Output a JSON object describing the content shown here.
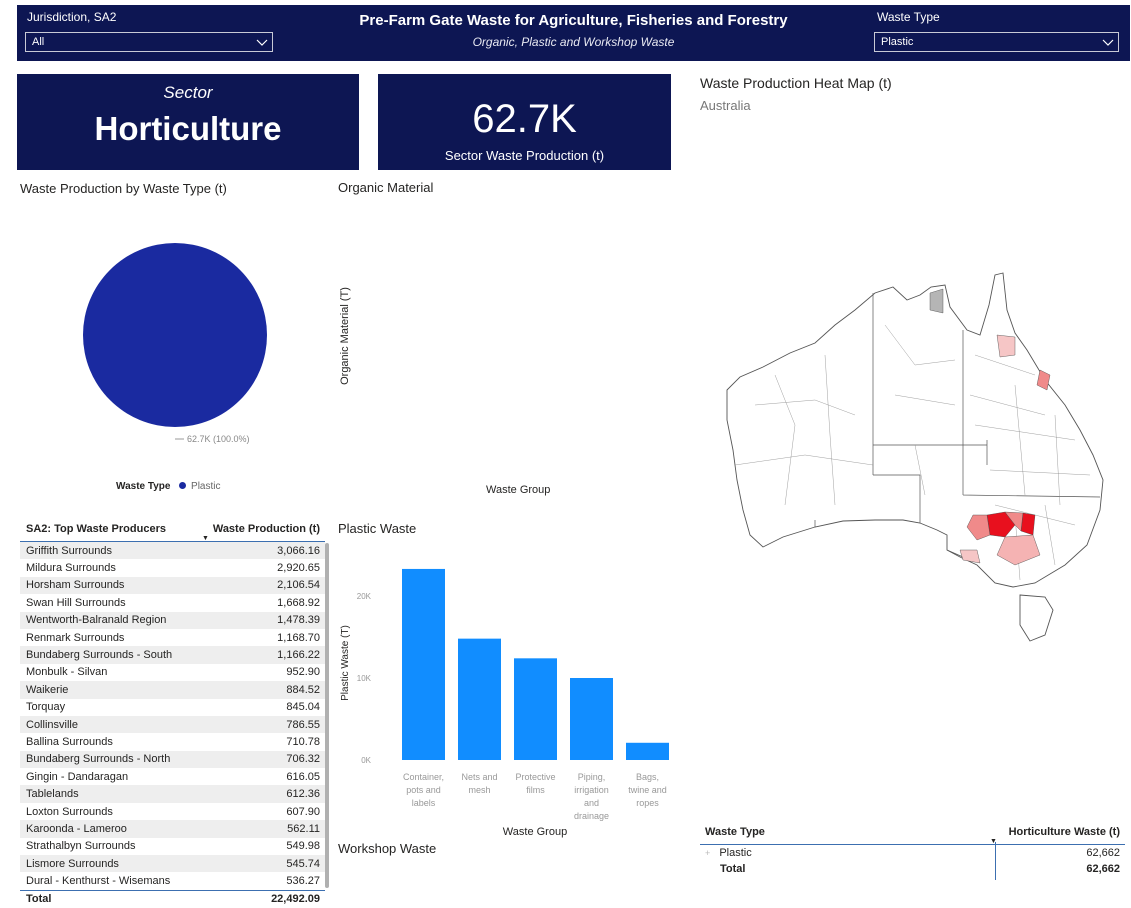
{
  "header": {
    "title": "Pre-Farm Gate Waste for Agriculture, Fisheries and Forestry",
    "subtitle": "Organic, Plastic and Workshop Waste"
  },
  "slicers": {
    "jurisdiction": {
      "label": "Jurisdiction, SA2",
      "value": "All"
    },
    "waste_type": {
      "label": "Waste Type",
      "value": "Plastic"
    }
  },
  "sector_card": {
    "caption": "Sector",
    "value": "Horticulture"
  },
  "production_card": {
    "value": "62.7K",
    "caption": "Sector Waste Production (t)"
  },
  "pie": {
    "title": "Waste Production by Waste Type (t)",
    "data_label": "62.7K (100.0%)",
    "legend_title": "Waste Type",
    "legend_entry": "Plastic",
    "color": "#1a2aa0",
    "chart_data": {
      "type": "pie",
      "categories": [
        "Plastic"
      ],
      "values": [
        62662
      ],
      "title": "Waste Production by Waste Type (t)"
    }
  },
  "organic": {
    "title": "Organic Material",
    "ylabel": "Organic Material (T)",
    "xlabel": "Waste Group"
  },
  "top_producers": {
    "col1": "SA2: Top Waste Producers",
    "col2": "Waste Production (t)",
    "rows": [
      {
        "name": "Griffith Surrounds",
        "value": "3,066.16"
      },
      {
        "name": "Mildura Surrounds",
        "value": "2,920.65"
      },
      {
        "name": "Horsham Surrounds",
        "value": "2,106.54"
      },
      {
        "name": "Swan Hill Surrounds",
        "value": "1,668.92"
      },
      {
        "name": "Wentworth-Balranald Region",
        "value": "1,478.39"
      },
      {
        "name": "Renmark Surrounds",
        "value": "1,168.70"
      },
      {
        "name": "Bundaberg Surrounds - South",
        "value": "1,166.22"
      },
      {
        "name": "Monbulk - Silvan",
        "value": "952.90"
      },
      {
        "name": "Waikerie",
        "value": "884.52"
      },
      {
        "name": "Torquay",
        "value": "845.04"
      },
      {
        "name": "Collinsville",
        "value": "786.55"
      },
      {
        "name": "Ballina Surrounds",
        "value": "710.78"
      },
      {
        "name": "Bundaberg Surrounds - North",
        "value": "706.32"
      },
      {
        "name": "Gingin - Dandaragan",
        "value": "616.05"
      },
      {
        "name": "Tablelands",
        "value": "612.36"
      },
      {
        "name": "Loxton Surrounds",
        "value": "607.90"
      },
      {
        "name": "Karoonda - Lameroo",
        "value": "562.11"
      },
      {
        "name": "Strathalbyn Surrounds",
        "value": "549.98"
      },
      {
        "name": "Lismore Surrounds",
        "value": "545.74"
      },
      {
        "name": "Dural - Kenthurst - Wisemans",
        "value": "536.27"
      }
    ],
    "total_label": "Total",
    "total_value": "22,492.09"
  },
  "plastic_chart": {
    "title": "Plastic Waste",
    "ylabel": "Plastic Waste (T)",
    "xlabel": "Waste Group",
    "color": "#118dff",
    "chart_data": {
      "type": "bar",
      "categories": [
        [
          "Container,",
          "pots and",
          "labels"
        ],
        [
          "Nets and",
          "mesh"
        ],
        [
          "Protective",
          "films"
        ],
        [
          "Piping,",
          "irrigation",
          "and",
          "drainage"
        ],
        [
          "Bags,",
          "twine and",
          "ropes"
        ]
      ],
      "values": [
        23300,
        14800,
        12400,
        10000,
        2100
      ],
      "yticks": [
        "0K",
        "10K",
        "20K"
      ],
      "ylim": [
        0,
        25000
      ]
    }
  },
  "workshop": {
    "title": "Workshop Waste"
  },
  "map": {
    "title": "Waste Production Heat Map (t)",
    "subtitle": "Australia"
  },
  "waste_type_table": {
    "col1": "Waste Type",
    "col2": "Horticulture Waste (t)",
    "rows": [
      {
        "name": "Plastic",
        "value": "62,662"
      }
    ],
    "total_label": "Total",
    "total_value": "62,662"
  }
}
